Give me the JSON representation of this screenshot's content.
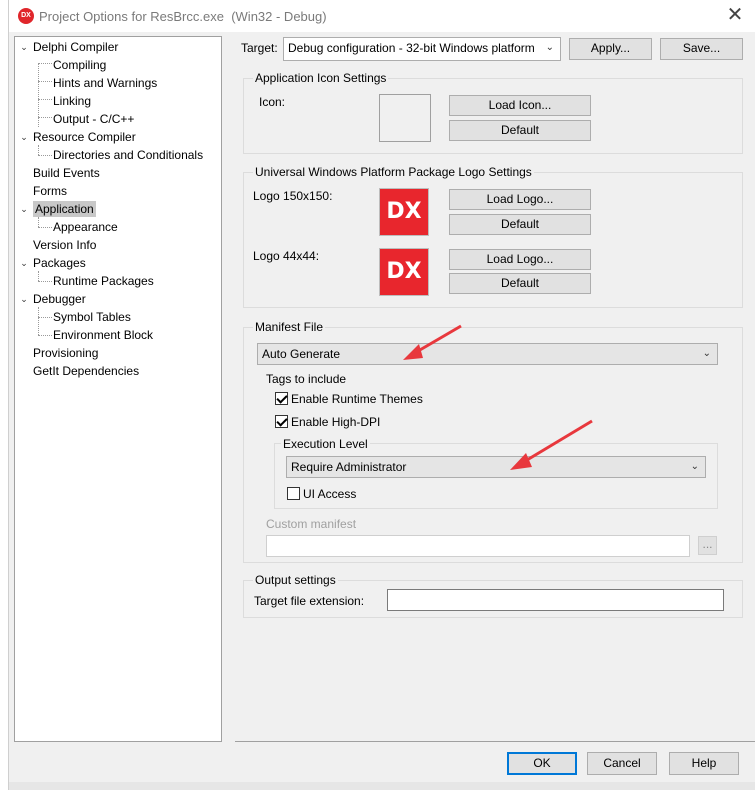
{
  "window": {
    "title": "Project Options for ResBrcc.exe",
    "title_suffix": "(Win32 - Debug)",
    "icon_text": "DX",
    "close_glyph": "✕"
  },
  "tree": [
    {
      "label": "Delphi Compiler",
      "toggle": "⌄"
    },
    {
      "label": "Compiling"
    },
    {
      "label": "Hints and Warnings"
    },
    {
      "label": "Linking"
    },
    {
      "label": "Output - C/C++"
    },
    {
      "label": "Resource Compiler",
      "toggle": "⌄"
    },
    {
      "label": "Directories and Conditionals"
    },
    {
      "label": "Build Events"
    },
    {
      "label": "Forms"
    },
    {
      "label": "Application",
      "toggle": "⌄",
      "selected": true
    },
    {
      "label": "Appearance"
    },
    {
      "label": "Version Info"
    },
    {
      "label": "Packages",
      "toggle": "⌄"
    },
    {
      "label": "Runtime Packages"
    },
    {
      "label": "Debugger",
      "toggle": "⌄"
    },
    {
      "label": "Symbol Tables"
    },
    {
      "label": "Environment Block"
    },
    {
      "label": "Provisioning"
    },
    {
      "label": "GetIt Dependencies"
    }
  ],
  "target": {
    "label": "Target:",
    "value": "Debug configuration - 32-bit Windows platform",
    "apply_label": "Apply...",
    "save_label": "Save..."
  },
  "app_icon": {
    "section_title": "Application Icon Settings",
    "icon_label": "Icon:",
    "load_label": "Load Icon...",
    "default_label": "Default"
  },
  "uwp": {
    "section_title": "Universal Windows Platform Package Logo Settings",
    "logo150_label": "Logo 150x150:",
    "logo44_label": "Logo 44x44:",
    "logo_text": "DX",
    "load_label": "Load Logo...",
    "default_label": "Default"
  },
  "manifest": {
    "section_title": "Manifest File",
    "mode_value": "Auto Generate",
    "tags_label": "Tags to include",
    "runtime_themes_label": "Enable Runtime Themes",
    "runtime_themes_checked": true,
    "high_dpi_label": "Enable High-DPI",
    "high_dpi_checked": true,
    "execution_level_label": "Execution Level",
    "execution_level_value": "Require Administrator",
    "ui_access_label": "UI Access",
    "ui_access_checked": false,
    "custom_manifest_label": "Custom manifest",
    "custom_manifest_value": "",
    "browse_label": "..."
  },
  "output": {
    "section_title": "Output settings",
    "extension_label": "Target file extension:",
    "extension_value": ""
  },
  "footer": {
    "ok_label": "OK",
    "cancel_label": "Cancel",
    "help_label": "Help"
  },
  "colors": {
    "accent": "#0078d7",
    "annotation_arrow": "#e8383d",
    "dx_red": "#e8262d"
  }
}
